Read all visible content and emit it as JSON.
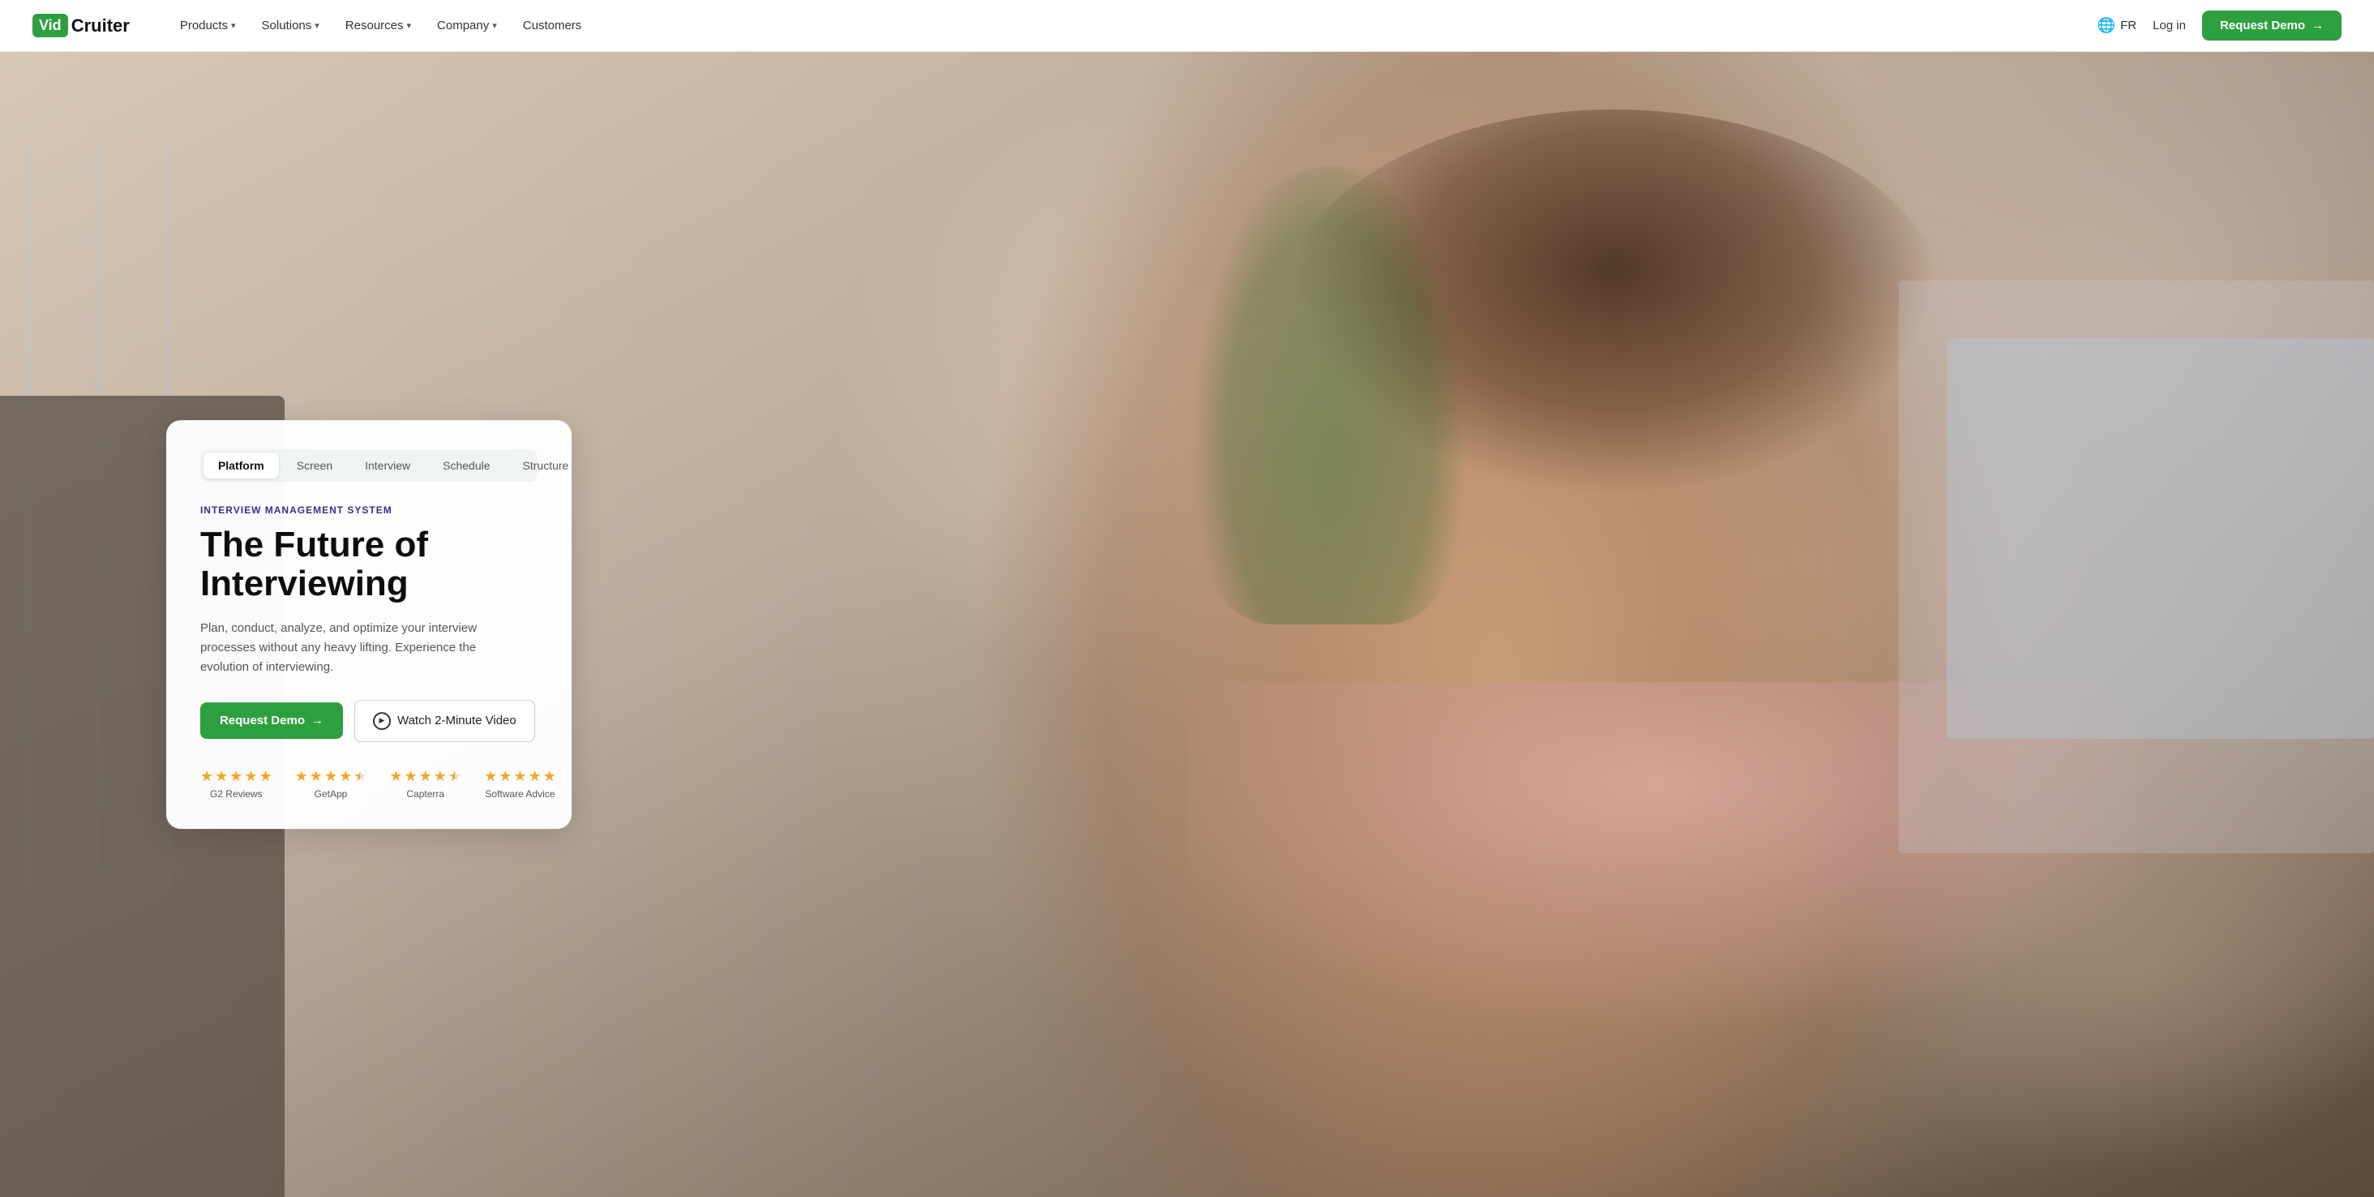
{
  "nav": {
    "logo_vid": "Vid",
    "logo_cruiter": "Cruiter",
    "items": [
      {
        "label": "Products",
        "has_dropdown": true
      },
      {
        "label": "Solutions",
        "has_dropdown": true
      },
      {
        "label": "Resources",
        "has_dropdown": true
      },
      {
        "label": "Company",
        "has_dropdown": true
      },
      {
        "label": "Customers",
        "has_dropdown": false
      }
    ],
    "lang": "FR",
    "login": "Log in",
    "request_demo": "Request Demo"
  },
  "hero": {
    "tabs": [
      {
        "label": "Platform",
        "active": true
      },
      {
        "label": "Screen",
        "active": false
      },
      {
        "label": "Interview",
        "active": false
      },
      {
        "label": "Schedule",
        "active": false
      },
      {
        "label": "Structure",
        "active": false
      }
    ],
    "category": "INTERVIEW MANAGEMENT SYSTEM",
    "title_line1": "The Future of",
    "title_line2": "Interviewing",
    "description": "Plan, conduct, analyze, and optimize your interview processes without any heavy lifting. Experience the evolution of interviewing.",
    "btn_demo": "Request Demo",
    "btn_demo_arrow": "→",
    "btn_video": "Watch 2-Minute Video",
    "ratings": [
      {
        "label": "G2 Reviews",
        "stars": 5,
        "half": false
      },
      {
        "label": "GetApp",
        "stars": 4,
        "half": true
      },
      {
        "label": "Capterra",
        "stars": 4,
        "half": true
      },
      {
        "label": "Software Advice",
        "stars": 5,
        "half": false
      }
    ]
  },
  "colors": {
    "accent_green": "#2d9f3f",
    "brand_purple": "#3a2d8f"
  }
}
